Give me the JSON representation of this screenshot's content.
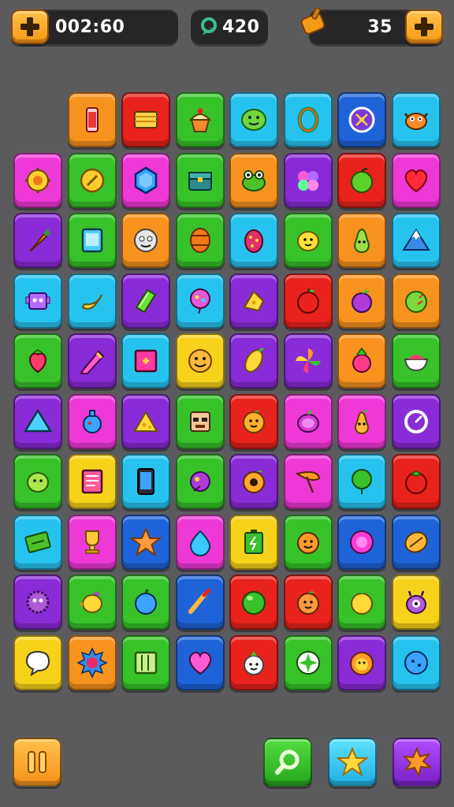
{
  "hud": {
    "timer": "002:60",
    "gems": "420",
    "moves": "35"
  },
  "colors": {
    "orange": "#f7931e",
    "red": "#e8221c",
    "green": "#37c22a",
    "cyan": "#27c3ef",
    "blue": "#1f63d8",
    "purple": "#8a2bd8",
    "magenta": "#ee39d6",
    "yellow": "#f7d21a"
  },
  "board": {
    "rows": [
      [
        null,
        {
          "color": "orange",
          "icon": "can-icon"
        },
        {
          "color": "red",
          "icon": "cake-slice-icon"
        },
        {
          "color": "green",
          "icon": "cupcake-icon"
        },
        {
          "color": "cyan",
          "icon": "green-blob-icon"
        },
        {
          "color": "cyan",
          "icon": "ring-icon"
        },
        {
          "color": "blue",
          "icon": "compass-icon"
        },
        {
          "color": "cyan",
          "icon": "crab-icon"
        }
      ],
      [
        {
          "color": "magenta",
          "icon": "flower-icon"
        },
        {
          "color": "green",
          "icon": "coin-icon"
        },
        {
          "color": "magenta",
          "icon": "hexagon-gem-icon"
        },
        {
          "color": "green",
          "icon": "chest-icon"
        },
        {
          "color": "orange",
          "icon": "frog-icon"
        },
        {
          "color": "purple",
          "icon": "clover-icon"
        },
        {
          "color": "red",
          "icon": "green-apple-icon"
        },
        {
          "color": "magenta",
          "icon": "heart-icon"
        }
      ],
      [
        {
          "color": "purple",
          "icon": "carrot-icon"
        },
        {
          "color": "green",
          "icon": "tablet-icon"
        },
        {
          "color": "orange",
          "icon": "face-ball-icon"
        },
        {
          "color": "green",
          "icon": "barrel-icon"
        },
        {
          "color": "cyan",
          "icon": "dotted-egg-icon"
        },
        {
          "color": "green",
          "icon": "lemon-face-icon"
        },
        {
          "color": "orange",
          "icon": "pear-face-icon"
        },
        {
          "color": "cyan",
          "icon": "mountain-icon"
        }
      ],
      [
        {
          "color": "cyan",
          "icon": "robot-icon"
        },
        {
          "color": "cyan",
          "icon": "banana-icon"
        },
        {
          "color": "purple",
          "icon": "green-gem-icon"
        },
        {
          "color": "cyan",
          "icon": "balloon-icon"
        },
        {
          "color": "purple",
          "icon": "cheese-icon"
        },
        {
          "color": "red",
          "icon": "red-apple-icon"
        },
        {
          "color": "orange",
          "icon": "plum-icon"
        },
        {
          "color": "orange",
          "icon": "lime-icon"
        }
      ],
      [
        {
          "color": "green",
          "icon": "strawberry-icon"
        },
        {
          "color": "purple",
          "icon": "pencil-icon"
        },
        {
          "color": "cyan",
          "icon": "picture-frame-icon"
        },
        {
          "color": "yellow",
          "icon": "smiley-icon"
        },
        {
          "color": "purple",
          "icon": "corn-icon"
        },
        {
          "color": "purple",
          "icon": "pinwheel-icon"
        },
        {
          "color": "orange",
          "icon": "radish-icon"
        },
        {
          "color": "green",
          "icon": "candy-bowl-icon"
        }
      ],
      [
        {
          "color": "purple",
          "icon": "triangle-gem-icon"
        },
        {
          "color": "magenta",
          "icon": "potion-icon"
        },
        {
          "color": "purple",
          "icon": "cheese-wedge-icon"
        },
        {
          "color": "green",
          "icon": "robot-face-icon"
        },
        {
          "color": "red",
          "icon": "orange-face-icon"
        },
        {
          "color": "magenta",
          "icon": "grape-icon"
        },
        {
          "color": "magenta",
          "icon": "pear-smile-icon"
        },
        {
          "color": "purple",
          "icon": "clock-icon"
        }
      ],
      [
        {
          "color": "green",
          "icon": "lime-face-icon"
        },
        {
          "color": "yellow",
          "icon": "notebook-icon"
        },
        {
          "color": "cyan",
          "icon": "phone-icon"
        },
        {
          "color": "green",
          "icon": "planet-icon"
        },
        {
          "color": "purple",
          "icon": "donut-icon"
        },
        {
          "color": "magenta",
          "icon": "leaf-icon"
        },
        {
          "color": "cyan",
          "icon": "green-balloon-icon"
        },
        {
          "color": "red",
          "icon": "tomato-icon"
        }
      ],
      [
        {
          "color": "cyan",
          "icon": "cash-icon"
        },
        {
          "color": "magenta",
          "icon": "trophy-icon"
        },
        {
          "color": "blue",
          "icon": "star-icon"
        },
        {
          "color": "magenta",
          "icon": "blue-drop-icon"
        },
        {
          "color": "yellow",
          "icon": "battery-icon"
        },
        {
          "color": "green",
          "icon": "orange-smile-icon"
        },
        {
          "color": "blue",
          "icon": "pink-orb-icon"
        },
        {
          "color": "blue",
          "icon": "bread-icon"
        }
      ],
      [
        {
          "color": "purple",
          "icon": "fuzzball-icon"
        },
        {
          "color": "green",
          "icon": "bird-icon"
        },
        {
          "color": "green",
          "icon": "blue-fruit-icon"
        },
        {
          "color": "blue",
          "icon": "paintbrush-icon"
        },
        {
          "color": "red",
          "icon": "green-ball-icon"
        },
        {
          "color": "red",
          "icon": "peach-face-icon"
        },
        {
          "color": "green",
          "icon": "yellow-fruit-icon"
        },
        {
          "color": "yellow",
          "icon": "monster-icon"
        }
      ],
      [
        {
          "color": "yellow",
          "icon": "speech-bubble-icon"
        },
        {
          "color": "orange",
          "icon": "sun-badge-icon"
        },
        {
          "color": "green",
          "icon": "book-icon"
        },
        {
          "color": "blue",
          "icon": "pink-heart-icon"
        },
        {
          "color": "red",
          "icon": "turnip-face-icon"
        },
        {
          "color": "green",
          "icon": "shuriken-icon"
        },
        {
          "color": "purple",
          "icon": "lion-icon"
        },
        {
          "color": "cyan",
          "icon": "blue-ball-icon"
        }
      ]
    ]
  },
  "bottom_bar": {
    "pause": {
      "icon": "pause-icon",
      "color": "#f7931e"
    },
    "hint": {
      "icon": "magnifier-icon",
      "color": "#37c22a"
    },
    "bonus": {
      "icon": "star-icon",
      "color": "#27c3ef"
    },
    "power": {
      "icon": "burst-icon",
      "color": "#8a2bd8"
    }
  }
}
